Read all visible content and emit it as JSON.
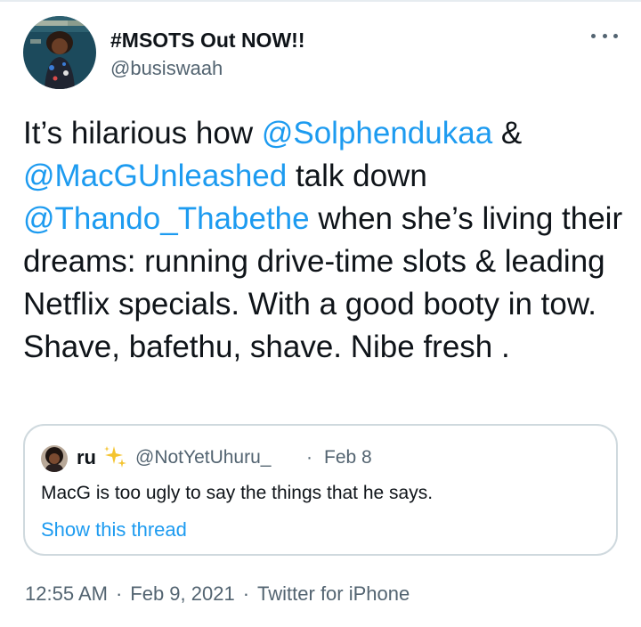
{
  "author": {
    "name": "#MSOTS Out NOW!!",
    "handle": "@busiswaah"
  },
  "tweet": {
    "text_parts": [
      {
        "text": "It’s hilarious how ",
        "mention": false
      },
      {
        "text": "@Solphendukaa",
        "mention": true
      },
      {
        "text": " & ",
        "mention": false
      },
      {
        "text": "@MacGUnleashed",
        "mention": true
      },
      {
        "text": " talk down ",
        "mention": false
      },
      {
        "text": "@Thando_Thabethe",
        "mention": true
      },
      {
        "text": " when she’s living their dreams: running drive-time slots  & leading Netflix specials. With a good booty in tow. Shave, bafethu, shave. Nibe fresh .",
        "mention": false
      }
    ]
  },
  "quote": {
    "name": "ru",
    "emoji": "sparkles-icon",
    "handle": "@NotYetUhuru_",
    "separator": "·",
    "date": "Feb 8",
    "text": "MacG is too ugly to say the things that he says.",
    "link": "Show this thread"
  },
  "meta": {
    "time": "12:55 AM",
    "date": "Feb 9, 2021",
    "source": "Twitter for iPhone",
    "separator": "·"
  },
  "colors": {
    "accent": "#1d9bf0",
    "secondary_text": "#536471",
    "border": "#cfd9de"
  }
}
